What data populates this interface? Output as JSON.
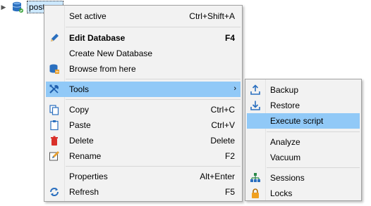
{
  "tree": {
    "node_label": "postgres"
  },
  "main_menu": {
    "items": [
      {
        "label": "Set active",
        "shortcut": "Ctrl+Shift+A"
      },
      {
        "label": "Edit Database",
        "shortcut": "F4"
      },
      {
        "label": "Create New Database",
        "shortcut": ""
      },
      {
        "label": "Browse from here",
        "shortcut": ""
      },
      {
        "label": "Tools",
        "shortcut": ""
      },
      {
        "label": "Copy",
        "shortcut": "Ctrl+C"
      },
      {
        "label": "Paste",
        "shortcut": "Ctrl+V"
      },
      {
        "label": "Delete",
        "shortcut": "Delete"
      },
      {
        "label": "Rename",
        "shortcut": "F2"
      },
      {
        "label": "Properties",
        "shortcut": "Alt+Enter"
      },
      {
        "label": "Refresh",
        "shortcut": "F5"
      }
    ],
    "submenu_arrow": "›"
  },
  "tools_submenu": {
    "items": [
      {
        "label": "Backup"
      },
      {
        "label": "Restore"
      },
      {
        "label": "Execute script"
      },
      {
        "label": "Analyze"
      },
      {
        "label": "Vacuum"
      },
      {
        "label": "Sessions"
      },
      {
        "label": "Locks"
      }
    ]
  },
  "colors": {
    "highlight": "#91c9f7",
    "menu_bg": "#f2f2f2",
    "tree_selection": "#cce8ff"
  },
  "icons": {
    "tree_node": "database-icon",
    "edit_database": "pencil-icon",
    "browse": "database-browse-icon",
    "tools": "tools-icon",
    "copy": "copy-icon",
    "paste": "paste-icon",
    "delete": "trash-icon",
    "rename": "rename-icon",
    "refresh": "refresh-icon",
    "backup": "upload-icon",
    "restore": "download-icon",
    "sessions": "network-icon",
    "locks": "lock-icon"
  }
}
